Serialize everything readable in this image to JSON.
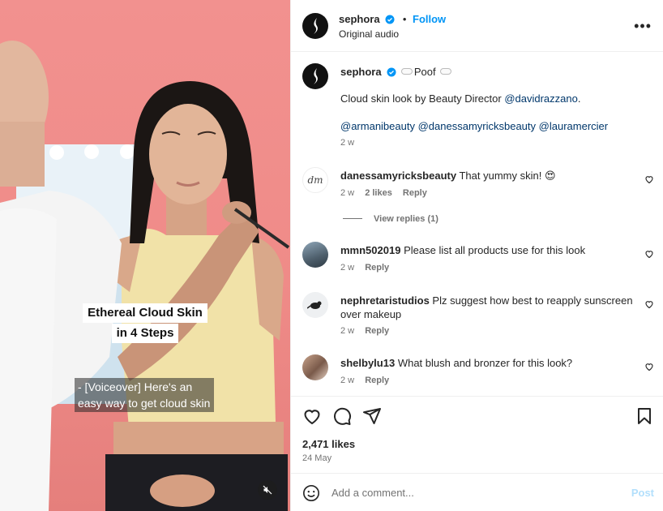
{
  "video": {
    "title_line1": "Ethereal Cloud Skin",
    "title_line2": "in 4 Steps",
    "subtitle": "- [Voiceover] Here's an easy way to get cloud skin"
  },
  "header": {
    "username": "sephora",
    "separator": "•",
    "follow_label": "Follow",
    "audio": "Original audio",
    "more": "•••"
  },
  "caption": {
    "username": "sephora",
    "tag": "Poof",
    "text_prefix": "Cloud skin look by Beauty Director ",
    "text_mention": "@davidrazzano",
    "text_suffix": ".",
    "tags": [
      "@armanibeauty",
      "@danessamyricksbeauty",
      "@lauramercier"
    ],
    "time": "2 w"
  },
  "comments": [
    {
      "username": "danessamyricksbeauty",
      "text": "That yummy skin! 😍",
      "time": "2 w",
      "likes": "2 likes",
      "reply": "Reply"
    },
    {
      "username": "mmn502019",
      "text": "Please list all products use for this look",
      "time": "2 w",
      "reply": "Reply"
    },
    {
      "username": "nephretaristudios",
      "text": "Plz suggest how best to reapply sunscreen over makeup",
      "time": "2 w",
      "reply": "Reply"
    },
    {
      "username": "shelbylu13",
      "text": "What blush and bronzer for this look?",
      "time": "2 w",
      "reply": "Reply"
    }
  ],
  "view_replies": "View replies (1)",
  "avatar_text": "dm",
  "actions": {
    "likes": "2,471 likes",
    "date": "24 May"
  },
  "add_comment": {
    "placeholder": "Add a comment...",
    "post_label": "Post"
  },
  "colors": {
    "link": "#0095f6",
    "mention": "#00376b",
    "secondary_text": "#737373",
    "video_background": "#f2918f"
  }
}
